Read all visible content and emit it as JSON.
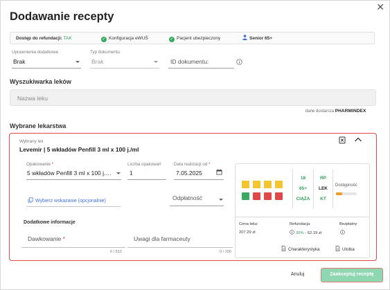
{
  "dialog": {
    "title": "Dodawanie recepty"
  },
  "status": {
    "refund_label": "Dostęp do refundacji:",
    "refund_value": "TAK",
    "ewus": "Konfiguracja eWUŚ",
    "insured": "Pacjent ubezpieczony",
    "senior": "Senior 65+"
  },
  "form": {
    "uprawnienia_label": "Uprawnienia dodatkowe",
    "uprawnienia_value": "Brak",
    "typ_label": "Typ dokumentu",
    "typ_value": "Brak",
    "id_placeholder": "ID dokumentu:"
  },
  "search": {
    "section_title": "Wyszukiwarka leków",
    "placeholder": "Nazwa leku",
    "provider_text": "dane dostarcza",
    "provider_logo": "PHARMINDEX"
  },
  "selected": {
    "section_title": "Wybrane lekarstwa",
    "card_label": "Wybrany lek",
    "drug_name": "Levemir | 5 wkładów Penfill 3 ml x 100 j./ml",
    "package_label": "Opakowanie",
    "package_value": "5 wkładów Penfill 3 ml x 100 j./ml",
    "count_label": "Liczba opakowań",
    "count_value": "1",
    "date_label": "Data realizacji od",
    "date_value": "7.05.2025",
    "indication_link": "Wybierz wskazanie (opcjonalnie)",
    "payment_placeholder": "Odpłatność",
    "additional_title": "Dodatkowe informacje",
    "dosage_placeholder": "Dawkowanie",
    "dosage_counter": "0 / 512",
    "notes_placeholder": "Uwagi dla farmaceuty",
    "notes_counter": "0 / 100",
    "required_mark": "*"
  },
  "drug_info": {
    "col1": [
      "18",
      "65+",
      "CIĄŻA"
    ],
    "col2": [
      "RP",
      "LEK",
      "KT"
    ],
    "availability_label": "Dostępność",
    "availability_level": 0.3,
    "price_label": "Cena leku:",
    "price_value": "207.29 zł",
    "refund_label": "Refundacja",
    "refund_percent": "30%",
    "refund_amount": "- 62.19 zł",
    "free_label": "Bezpłatny",
    "char_link": "Charakterystyka",
    "leaflet_link": "Ulotka"
  },
  "footer": {
    "cancel": "Anuluj",
    "accept": "Zaakceptuj receptę"
  },
  "colors": {
    "accent_green": "#2e9d54",
    "highlight_red": "#e04848",
    "link_blue": "#3f6fd8",
    "button_green": "#8fd7b0"
  }
}
